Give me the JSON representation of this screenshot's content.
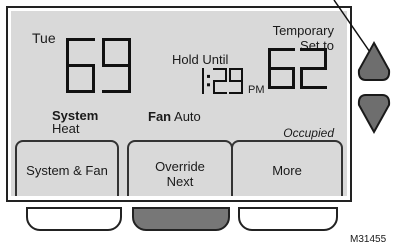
{
  "display": {
    "day": "Tue",
    "current_temp": "69",
    "temporary_label_line1": "Temporary",
    "temporary_label_line2": "Set to",
    "setpoint": "62",
    "hold_label": "Hold Until",
    "hold_time": "1:29",
    "hold_ampm": "PM",
    "system_heading": "System",
    "system_value": "Heat",
    "fan_heading": "Fan",
    "fan_value": "Auto",
    "status": "Occupied"
  },
  "softkeys": [
    {
      "label_line1": "System & Fan",
      "label_line2": ""
    },
    {
      "label_line1": "Override",
      "label_line2": "Next"
    },
    {
      "label_line1": "More",
      "label_line2": ""
    }
  ],
  "controls": {
    "up_icon": "up-arrow-icon",
    "down_icon": "down-arrow-icon",
    "colors": {
      "lcd_background": "#d9d9d9",
      "arrow_fill": "#6e6e6e",
      "active_button_fill": "#777777"
    }
  },
  "footer": {
    "model_code": "M31455"
  }
}
